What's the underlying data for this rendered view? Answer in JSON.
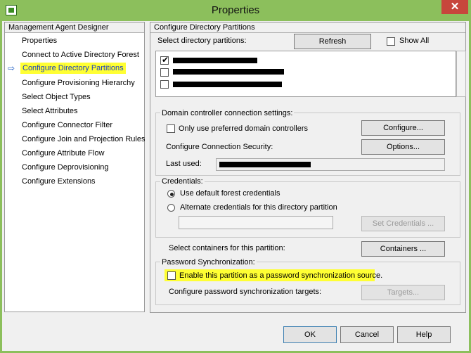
{
  "window": {
    "title": "Properties",
    "close": "✕"
  },
  "left": {
    "header": "Management Agent Designer",
    "items": [
      "Properties",
      "Connect to Active Directory Forest",
      "Configure Directory Partitions",
      "Configure Provisioning Hierarchy",
      "Select Object Types",
      "Select Attributes",
      "Configure Connector Filter",
      "Configure Join and Projection Rules",
      "Configure Attribute Flow",
      "Configure Deprovisioning",
      "Configure Extensions"
    ],
    "selected_arrow": "⇨"
  },
  "right": {
    "header": "Configure Directory Partitions",
    "select_label": "Select directory partitions:",
    "refresh": "Refresh",
    "show_all": "Show All",
    "dc": {
      "legend": "Domain controller connection settings:",
      "preferred": "Only use preferred domain controllers",
      "configure_btn": "Configure...",
      "security_label": "Configure Connection Security:",
      "options_btn": "Options...",
      "last_used_label": "Last used:"
    },
    "cred": {
      "legend": "Credentials:",
      "default": "Use default forest credentials",
      "alternate": "Alternate credentials for this directory partition",
      "set_btn": "Set Credentials ..."
    },
    "containers_label": "Select containers for this partition:",
    "containers_btn": "Containers ...",
    "pwd": {
      "legend": "Password Synchronization:",
      "enable": "Enable this partition as a password synchronization source.",
      "targets_label": "Configure password synchronization targets:",
      "targets_btn": "Targets..."
    }
  },
  "footer": {
    "ok": "OK",
    "cancel": "Cancel",
    "help": "Help"
  }
}
